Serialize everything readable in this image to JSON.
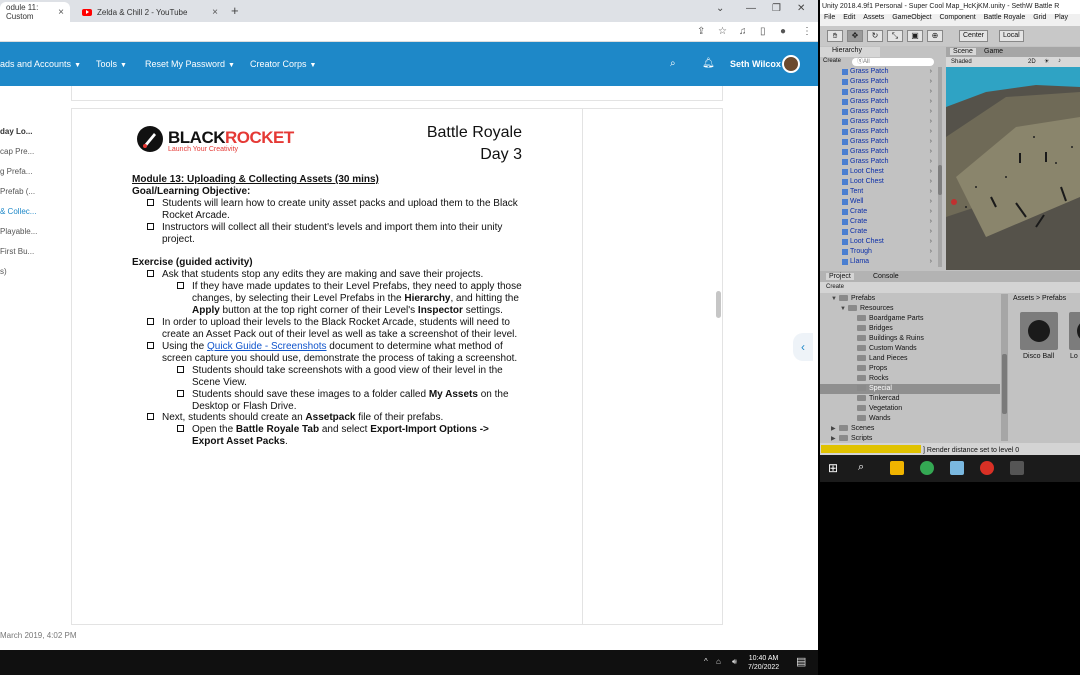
{
  "browser": {
    "tabs": [
      {
        "label": "odule 11: Custom"
      },
      {
        "label": "Zelda & Chill 2 - YouTube"
      }
    ],
    "new_tab_symbol": "+"
  },
  "navbar": {
    "items": [
      "ads and Accounts",
      "Tools",
      "Reset My Password",
      "Creator Corps"
    ],
    "user_name": "Seth Wilcox"
  },
  "sidebar": {
    "items": [
      "day Lo...",
      "cap Pre...",
      "g Prefa...",
      "Prefab (...",
      "& Collec...",
      "Playable...",
      "First Bu...",
      "s)"
    ],
    "active_index": 4
  },
  "footer": {
    "date": "March 2019, 4:02 PM"
  },
  "document": {
    "logo_black": "BLACK",
    "logo_red": "ROCKET",
    "logo_tagline": "Launch Your Creativity",
    "title_line1": "Battle Royale",
    "title_line2": "Day 3",
    "module_heading": "Module 13: Uploading & Collecting Assets (30 mins)",
    "goal_heading": "Goal/Learning Objective:",
    "goal_1a": "Students will learn how to create unity asset packs and upload them to the Black",
    "goal_1b": "Rocket Arcade.",
    "goal_2a": "Instructors will collect all their student's levels and import them into their unity",
    "goal_2b": "project.",
    "exercise_heading": "Exercise (guided activity)",
    "ex1": "Ask that students stop any edits they are making and save their projects.",
    "ex1a_1": "If they have made updates to their Level Prefabs, they need to apply those",
    "ex1a_2a": "changes, by selecting their Level Prefabs in the ",
    "ex1a_2b": "Hierarchy",
    "ex1a_2c": ", and hitting the",
    "ex1a_3a": "Apply",
    "ex1a_3b": " button at the top right corner of their Level's ",
    "ex1a_3c": "Inspector",
    "ex1a_3d": " settings.",
    "ex2a": "In order to upload their levels to the Black Rocket Arcade, students will need to",
    "ex2b": "create an Asset Pack out of their level as well as take a screenshot of their level.",
    "ex3a_1": "Using the ",
    "ex3a_link": "Quick Guide - Screenshots",
    "ex3a_2": " document to determine what method of",
    "ex3b": "screen capture you should use, demonstrate the process of taking a screenshot.",
    "ex3c_1": "Students should take screenshots with a good view of their level in the",
    "ex3c_2": "Scene View.",
    "ex3d_1a": "Students should save these images to a folder called ",
    "ex3d_1b": "My Assets",
    "ex3d_1c": " on the",
    "ex3d_2": "Desktop or Flash Drive.",
    "ex4a": "Next, students should create an ",
    "ex4b": "Assetpack",
    "ex4c": " file of their prefabs.",
    "ex4d_1a": "Open the ",
    "ex4d_1b": "Battle Royale Tab",
    "ex4d_1c": " and select ",
    "ex4d_1d": "Export-Import Options ->",
    "ex4d_2": "Export Asset Packs",
    "ex4d_3": "."
  },
  "taskbar": {
    "time": "10:40 AM",
    "date": "7/20/2022"
  },
  "unity": {
    "title": "Unity 2018.4.9f1 Personal - Super Cool Map_HcKjKM.unity - SethW Battle R",
    "menu": [
      "File",
      "Edit",
      "Assets",
      "GameObject",
      "Component",
      "Battle Royale",
      "Grid",
      "Play"
    ],
    "pivot": "Center",
    "space": "Local",
    "hierarchy_tab": "Hierarchy",
    "create_label": "Create",
    "search_placeholder": "ⓠAll",
    "hierarchy_items": [
      "Grass Patch",
      "Grass Patch",
      "Grass Patch",
      "Grass Patch",
      "Grass Patch",
      "Grass Patch",
      "Grass Patch",
      "Grass Patch",
      "Grass Patch",
      "Grass Patch",
      "Loot Chest",
      "Loot Chest",
      "Tent",
      "Well",
      "Crate",
      "Crate",
      "Crate",
      "Loot Chest",
      "Trough",
      "Llama"
    ],
    "scene_tab": "Scene",
    "game_tab": "Game",
    "shading": "Shaded",
    "mode_2d": "2D",
    "project_tab": "Project",
    "console_tab": "Console",
    "tree_items": [
      {
        "label": "Prefabs",
        "indent": 1,
        "expanded": true
      },
      {
        "label": "Resources",
        "indent": 2,
        "expanded": true
      },
      {
        "label": "Boardgame Parts",
        "indent": 3
      },
      {
        "label": "Bridges",
        "indent": 3
      },
      {
        "label": "Buildings & Ruins",
        "indent": 3
      },
      {
        "label": "Custom Wands",
        "indent": 3
      },
      {
        "label": "Land Pieces",
        "indent": 3
      },
      {
        "label": "Props",
        "indent": 3
      },
      {
        "label": "Rocks",
        "indent": 3
      },
      {
        "label": "Special",
        "indent": 3,
        "selected": true
      },
      {
        "label": "Tinkercad",
        "indent": 3
      },
      {
        "label": "Vegetation",
        "indent": 3
      },
      {
        "label": "Wands",
        "indent": 3
      },
      {
        "label": "Scenes",
        "indent": 1
      },
      {
        "label": "Scripts",
        "indent": 1
      }
    ],
    "breadcrumb_assets": "Assets",
    "breadcrumb_prefabs": "Prefabs",
    "assets": [
      "Disco Ball",
      "Lo"
    ],
    "status_text": "Render distance set to level 0"
  }
}
